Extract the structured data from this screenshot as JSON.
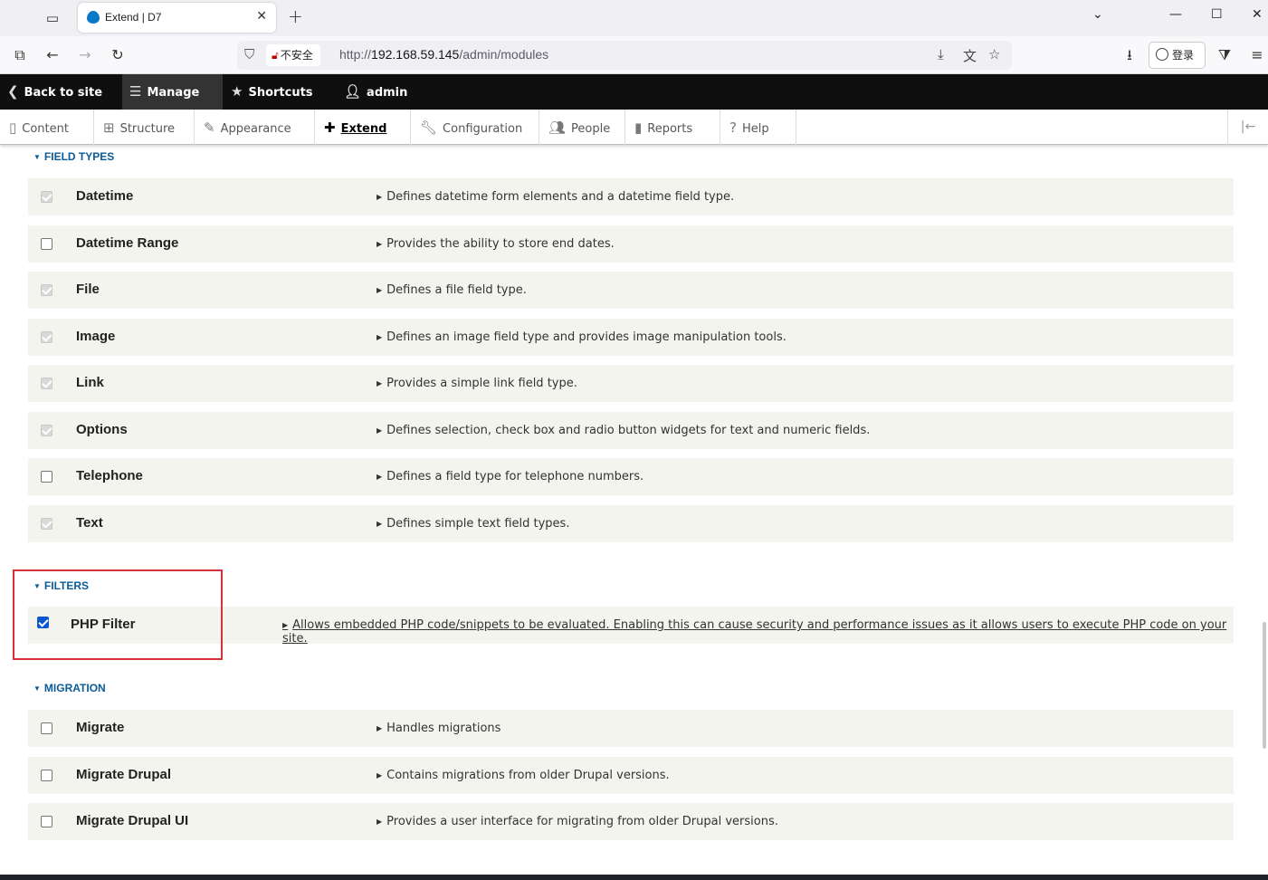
{
  "browser": {
    "tab_title": "Extend | D7",
    "new_tab": "+",
    "close_tab": "✕",
    "security_label": "不安全",
    "url_prefix": "http://",
    "url_host": "192.168.59.145",
    "url_path": "/admin/modules",
    "login_label": "登录"
  },
  "toolbar": {
    "back_to_site": "Back to site",
    "manage": "Manage",
    "shortcuts": "Shortcuts",
    "user": "admin"
  },
  "tray": {
    "items": [
      {
        "label": "Content",
        "icon": "file-icon"
      },
      {
        "label": "Structure",
        "icon": "sitemap-icon"
      },
      {
        "label": "Appearance",
        "icon": "brush-icon"
      },
      {
        "label": "Extend",
        "icon": "puzzle-icon",
        "active": true
      },
      {
        "label": "Configuration",
        "icon": "wrench-icon"
      },
      {
        "label": "People",
        "icon": "people-icon"
      },
      {
        "label": "Reports",
        "icon": "bar-chart-icon"
      },
      {
        "label": "Help",
        "icon": "help-icon"
      }
    ]
  },
  "sections": {
    "field_types": {
      "title": "FIELD TYPES",
      "modules": [
        {
          "name": "Datetime",
          "description": "Defines datetime form elements and a datetime field type.",
          "state": "required"
        },
        {
          "name": "Datetime Range",
          "description": "Provides the ability to store end dates.",
          "state": "unchecked"
        },
        {
          "name": "File",
          "description": "Defines a file field type.",
          "state": "required"
        },
        {
          "name": "Image",
          "description": "Defines an image field type and provides image manipulation tools.",
          "state": "required"
        },
        {
          "name": "Link",
          "description": "Provides a simple link field type.",
          "state": "required"
        },
        {
          "name": "Options",
          "description": "Defines selection, check box and radio button widgets for text and numeric fields.",
          "state": "required"
        },
        {
          "name": "Telephone",
          "description": "Defines a field type for telephone numbers.",
          "state": "unchecked"
        },
        {
          "name": "Text",
          "description": "Defines simple text field types.",
          "state": "required"
        }
      ]
    },
    "filters": {
      "title": "FILTERS",
      "modules": [
        {
          "name": "PHP Filter",
          "description": "Allows embedded PHP code/snippets to be evaluated. Enabling this can cause security and performance issues as it allows users to execute PHP code on your site.",
          "state": "checked"
        }
      ]
    },
    "migration": {
      "title": "MIGRATION",
      "modules": [
        {
          "name": "Migrate",
          "description": "Handles migrations",
          "state": "unchecked"
        },
        {
          "name": "Migrate Drupal",
          "description": "Contains migrations from older Drupal versions.",
          "state": "unchecked"
        },
        {
          "name": "Migrate Drupal UI",
          "description": "Provides a user interface for migrating from older Drupal versions.",
          "state": "unchecked"
        }
      ]
    }
  },
  "colors": {
    "toolbar_bg": "#0f0f0f",
    "section_title": "#0a5b96",
    "row_bg": "#f3f4ee",
    "highlight": "#d6323d",
    "checkbox_checked": "#0b57d0"
  }
}
